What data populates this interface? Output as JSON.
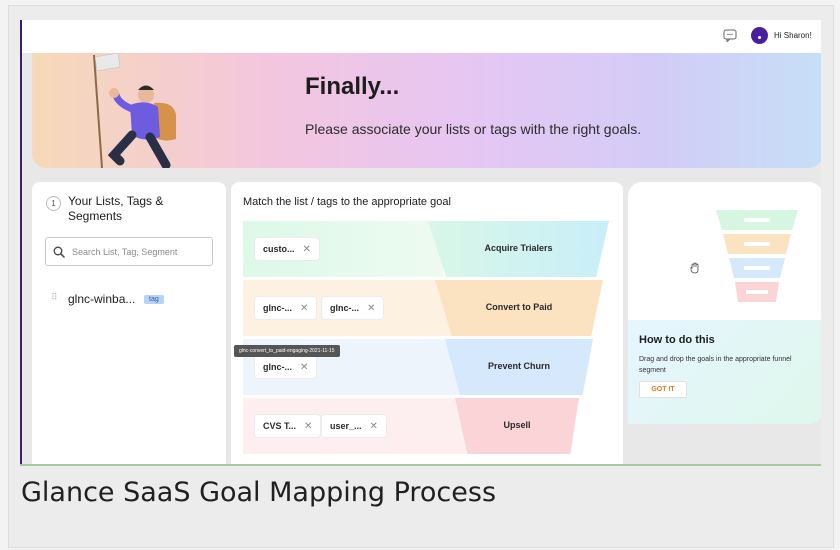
{
  "topbar": {
    "greeting": "Hi Sharon!"
  },
  "hero": {
    "title": "Finally...",
    "subtitle": "Please associate your lists or tags with the right goals."
  },
  "left_panel": {
    "step_number": "1",
    "title": "Your Lists, Tags & Segments",
    "search_placeholder": "Search List, Tag, Segment",
    "items": [
      {
        "name": "glnc-winba...",
        "badge": "tag"
      }
    ]
  },
  "mid_panel": {
    "title": "Match the list / tags to the appropriate goal",
    "rows": [
      {
        "goal": "Acquire Trialers",
        "chips": [
          "custo..."
        ]
      },
      {
        "goal": "Convert to Paid",
        "chips": [
          "glnc-...",
          "glnc-..."
        ]
      },
      {
        "goal": "Prevent Churn",
        "chips": [
          "glnc-..."
        ]
      },
      {
        "goal": "Upsell",
        "chips": [
          "CVS T...",
          "user_..."
        ]
      }
    ],
    "tooltip": "glnc-convert_to_paid-engaging-2021-11-15"
  },
  "right_panel": {
    "howto_title": "How to do this",
    "howto_text": "Drag and drop the goals in the appropriate funnel segment",
    "got_it_label": "GOT IT"
  },
  "caption": "Glance SaaS Goal Mapping Process",
  "colors": {
    "sidebar_accent": "#3b1e6e",
    "avatar": "#4a1f9e",
    "acquire": "#d9f7e6",
    "convert": "#fbe3c2",
    "churn": "#d6e8fb",
    "upsell": "#fbd4d8",
    "got_it": "#e07b1f"
  },
  "icons": [
    "chat-icon",
    "avatar",
    "search-icon",
    "drag-handle-icon",
    "remove-chip-icon",
    "hand-cursor-icon",
    "funnel-illustration"
  ]
}
